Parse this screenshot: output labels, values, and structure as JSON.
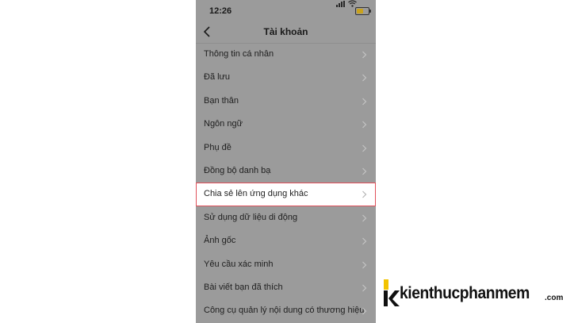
{
  "status_bar": {
    "time": "12:26",
    "battery_level": 0.6,
    "battery_color": "#c9a21c"
  },
  "nav": {
    "title": "Tài khoản",
    "back_icon": "chevron-left-icon"
  },
  "menu": {
    "items": [
      {
        "label": "Thông tin cá nhân"
      },
      {
        "label": "Đã lưu"
      },
      {
        "label": "Bạn thân"
      },
      {
        "label": "Ngôn ngữ"
      },
      {
        "label": "Phụ đề"
      },
      {
        "label": "Đồng bộ danh bạ"
      },
      {
        "label": "Chia sẻ lên ứng dụng khác",
        "highlighted": true
      },
      {
        "label": "Sử dụng dữ liệu di động"
      },
      {
        "label": "Ảnh gốc"
      },
      {
        "label": "Yêu cầu xác minh"
      },
      {
        "label": "Bài viết bạn đã thích"
      },
      {
        "label": "Công cụ quản lý nội dung có thương hiệu"
      }
    ],
    "chevron_icon": "chevron-right-icon",
    "highlight_color": "#e0505a"
  },
  "watermark": {
    "text": "kienthucphanmem",
    "tld": ".com",
    "accent_color": "#f2c300"
  }
}
